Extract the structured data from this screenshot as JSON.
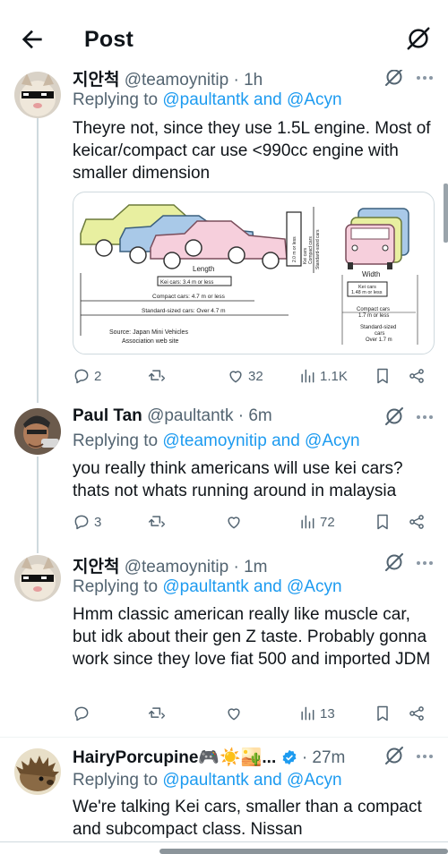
{
  "header": {
    "title": "Post"
  },
  "tweets": [
    {
      "name": "지안척",
      "handle": "@teamoynitip",
      "time": "· 1h",
      "replying_prefix": "Replying to",
      "replying_mentions": "@paultantk and @Acyn",
      "text": "Theyre not, since they use 1.5L engine. Most of keicar/compact car use <990cc engine with smaller dimension",
      "replies": "2",
      "reposts": "",
      "likes": "32",
      "views": "1.1K"
    },
    {
      "name": "Paul Tan",
      "handle": "@paultantk",
      "time": "· 6m",
      "replying_prefix": "Replying to",
      "replying_mentions": "@teamoynitip and @Acyn",
      "text": "you really think americans will use kei cars? thats not whats running around in malaysia",
      "replies": "3",
      "reposts": "",
      "likes": "",
      "views": "72"
    },
    {
      "name": "지안척",
      "handle": "@teamoynitip",
      "time": "· 1m",
      "replying_prefix": "Replying to",
      "replying_mentions": "@paultantk and @Acyn",
      "text": "Hmm classic american really like muscle car, but idk about their gen Z taste. Probably gonna work since they love fiat 500 and imported JDM",
      "replies": "",
      "reposts": "",
      "likes": "",
      "views": "13"
    },
    {
      "name": "HairyPorcupine🎮☀️🏜️...",
      "handle": "",
      "time": "· 27m",
      "replying_prefix": "Replying to",
      "replying_mentions": "@paultantk and @Acyn",
      "text": "We're talking Kei cars, smaller than a compact and subcompact class. Nissan"
    }
  ],
  "diagram": {
    "length_label": "Length",
    "kei_length": "Kei cars: 3.4 m or less",
    "compact_length": "Compact cars: 4.7 m or less",
    "standard_length": "Standard-sized cars: Over 4.7 m",
    "source_line1": "Source: Japan Mini Vehicles",
    "source_line2": "Association web site",
    "height_label_a": "2.0 m or less",
    "height_label_b": "Kei cars",
    "height_label_c": "Compact cars",
    "height_label_d": "Standard-sized cars",
    "width_label": "Width",
    "kei_width_a": "Kei cars",
    "kei_width_b": "1.48 m or less",
    "compact_width_a": "Compact cars",
    "compact_width_b": "1.7 m or less",
    "standard_width_a": "Standard-sized",
    "standard_width_b": "cars",
    "standard_width_c": "Over 1.7 m"
  },
  "colors": {
    "accent": "#1d9bf0",
    "secondary_text": "#536471",
    "divider": "#eff3f4"
  }
}
